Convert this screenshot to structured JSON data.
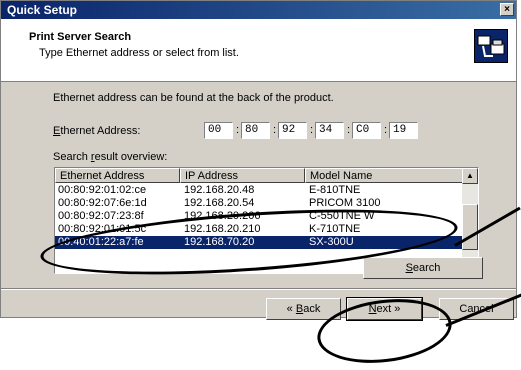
{
  "window": {
    "title": "Quick Setup",
    "close_glyph": "×"
  },
  "header": {
    "title": "Print Server Search",
    "subtitle": "Type Ethernet address or select from list.",
    "logo_icon": "network-printer-icon"
  },
  "body": {
    "info_text": "Ethernet address can be found at the back of the product.",
    "address_label": "Ethernet Address:",
    "address_octets": [
      "00",
      "80",
      "92",
      "34",
      "C0",
      "19"
    ],
    "overview_label": "Search result overview:",
    "columns": [
      "Ethernet Address",
      "IP Address",
      "Model Name"
    ],
    "rows": [
      [
        "00:80:92:01:02:ce",
        "192.168.20.48",
        "E-810TNE"
      ],
      [
        "00:80:92:07:6e:1d",
        "192.168.20.54",
        "PRICOM 3100"
      ],
      [
        "00:80:92:07:23:8f",
        "192.168.20.206",
        "C-550TNE W"
      ],
      [
        "00:80:92:01:01:5c",
        "192.168.20.210",
        "K-710TNE"
      ],
      [
        "00:40:01:22:a7:fe",
        "192.168.70.20",
        "SX-300U"
      ]
    ],
    "selected_row": 4,
    "search_button": "Search"
  },
  "footer": {
    "back": "« Back",
    "next": "Next »",
    "cancel": "Cancel"
  }
}
